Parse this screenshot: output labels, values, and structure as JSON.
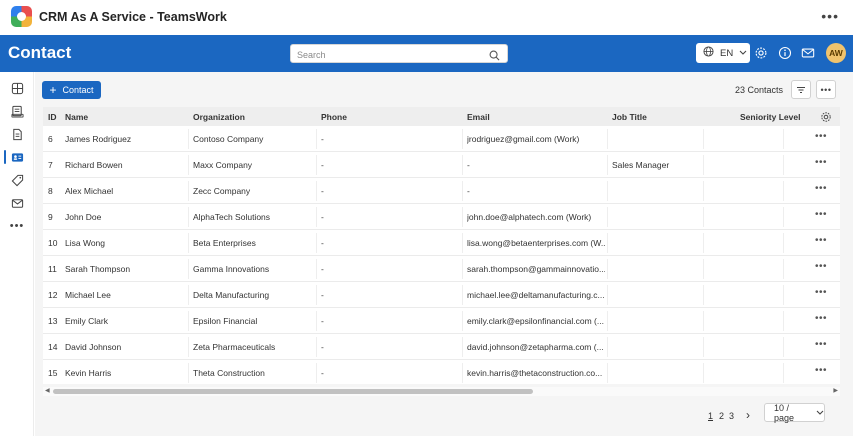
{
  "titlebar": {
    "app_title": "CRM As A Service - TeamsWork"
  },
  "header": {
    "page_title": "Contact",
    "search_placeholder": "Search",
    "language": "EN",
    "avatar_initials": "AW"
  },
  "toolbar": {
    "add_label": "Contact",
    "count_label": "23 Contacts"
  },
  "table": {
    "columns": [
      "ID",
      "Name",
      "Organization",
      "Phone",
      "Email",
      "Job Title",
      "Seniority Level"
    ],
    "rows": [
      {
        "id": "6",
        "name": "James Rodriguez",
        "org": "Contoso Company",
        "phone": "-",
        "email": "jrodriguez@gmail.com (Work)",
        "job": ""
      },
      {
        "id": "7",
        "name": "Richard Bowen",
        "org": "Maxx Company",
        "phone": "-",
        "email": "-",
        "job": "Sales Manager"
      },
      {
        "id": "8",
        "name": "Alex Michael",
        "org": "Zecc Company",
        "phone": "-",
        "email": "-",
        "job": ""
      },
      {
        "id": "9",
        "name": "John Doe",
        "org": "AlphaTech Solutions",
        "phone": "-",
        "email": "john.doe@alphatech.com (Work)",
        "job": ""
      },
      {
        "id": "10",
        "name": "Lisa Wong",
        "org": "Beta Enterprises",
        "phone": "-",
        "email": "lisa.wong@betaenterprises.com (W...",
        "job": ""
      },
      {
        "id": "11",
        "name": "Sarah Thompson",
        "org": "Gamma Innovations",
        "phone": "-",
        "email": "sarah.thompson@gammainnovatio...",
        "job": ""
      },
      {
        "id": "12",
        "name": "Michael Lee",
        "org": "Delta Manufacturing",
        "phone": "-",
        "email": "michael.lee@deltamanufacturing.c...",
        "job": ""
      },
      {
        "id": "13",
        "name": "Emily Clark",
        "org": "Epsilon Financial",
        "phone": "-",
        "email": "emily.clark@epsilonfinancial.com (...",
        "job": ""
      },
      {
        "id": "14",
        "name": "David Johnson",
        "org": "Zeta Pharmaceuticals",
        "phone": "-",
        "email": "david.johnson@zetapharma.com (...",
        "job": ""
      },
      {
        "id": "15",
        "name": "Kevin Harris",
        "org": "Theta Construction",
        "phone": "-",
        "email": "kevin.harris@thetaconstruction.co...",
        "job": ""
      }
    ]
  },
  "pagination": {
    "pages": [
      "1",
      "2",
      "3"
    ],
    "current": "1",
    "next": "›",
    "page_size": "10 / page"
  },
  "colors": {
    "brand": "#1b67c1",
    "avatar": "#f0c36d"
  }
}
